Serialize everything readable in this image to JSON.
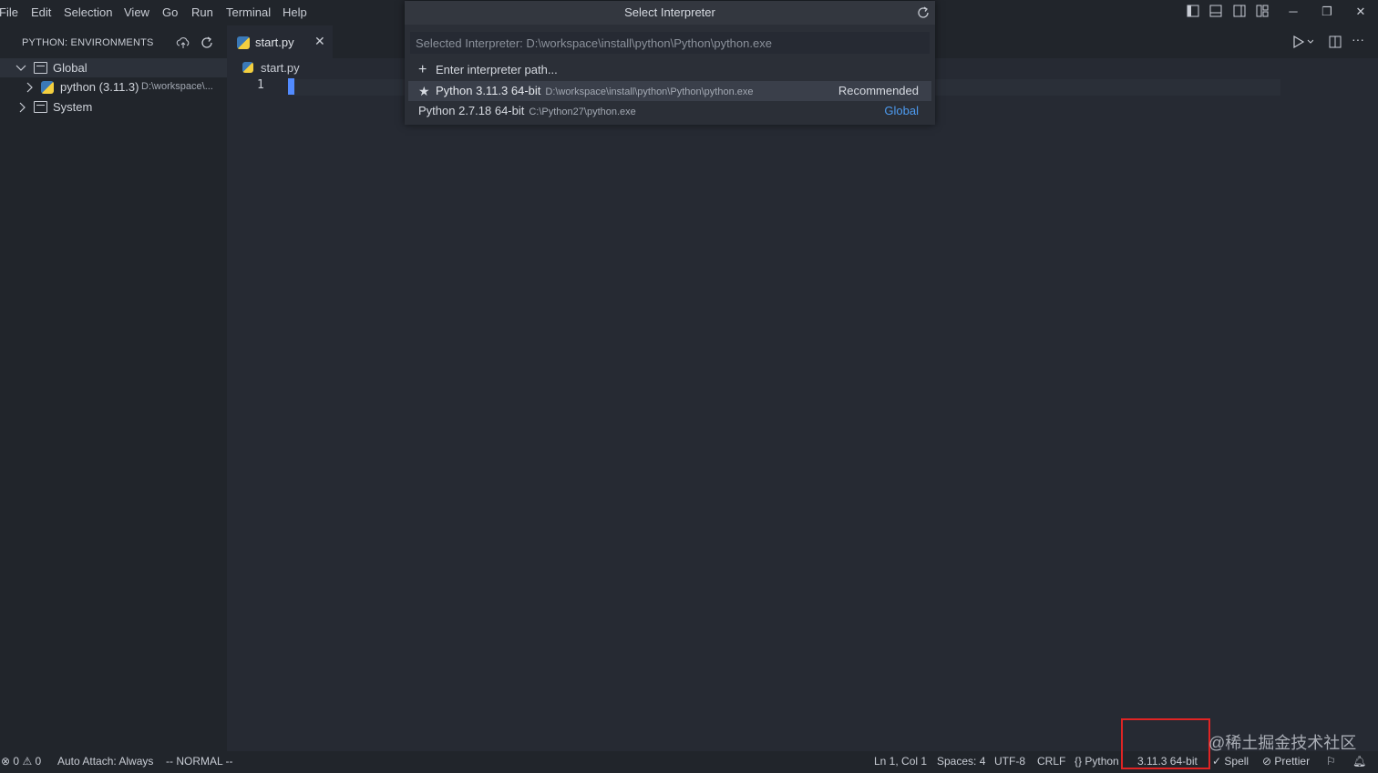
{
  "menu": [
    "File",
    "Edit",
    "Selection",
    "View",
    "Go",
    "Run",
    "Terminal",
    "Help"
  ],
  "sidebar": {
    "title": "PYTHON: ENVIRONMENTS",
    "tree": [
      {
        "label": "Global",
        "expanded": true
      },
      {
        "label": "python (3.11.3)",
        "detail": "D:\\workspace\\..."
      },
      {
        "label": "System",
        "expanded": false
      }
    ]
  },
  "editor": {
    "tab_label": "start.py",
    "breadcrumb": "start.py",
    "line_number": "1"
  },
  "quick_pick": {
    "title": "Select Interpreter",
    "placeholder": "Selected Interpreter: D:\\workspace\\install\\python\\Python\\python.exe",
    "items": [
      {
        "label": "Enter interpreter path...",
        "icon": "plus-icon"
      },
      {
        "label": "Python 3.11.3 64-bit",
        "description": "D:\\workspace\\install\\python\\Python\\python.exe",
        "tag": "Recommended",
        "icon": "star-icon"
      },
      {
        "label": "Python 2.7.18 64-bit",
        "description": "C:\\Python27\\python.exe",
        "tag": "Global"
      }
    ]
  },
  "statusbar": {
    "errors": "0",
    "warnings": "0",
    "auto_attach": "Auto Attach: Always",
    "vim_mode": "-- NORMAL --",
    "cursor_pos": "Ln 1, Col 1",
    "spaces": "Spaces: 4",
    "encoding": "UTF-8",
    "eol": "CRLF",
    "language": "Python",
    "interpreter": "3.11.3 64-bit",
    "spell": "Spell",
    "prettier": "Prettier"
  },
  "watermark": "@稀土掘金技术社区",
  "colors": {
    "accent": "#528bff",
    "highlight": "#e02424",
    "link": "#4d9bf0"
  }
}
